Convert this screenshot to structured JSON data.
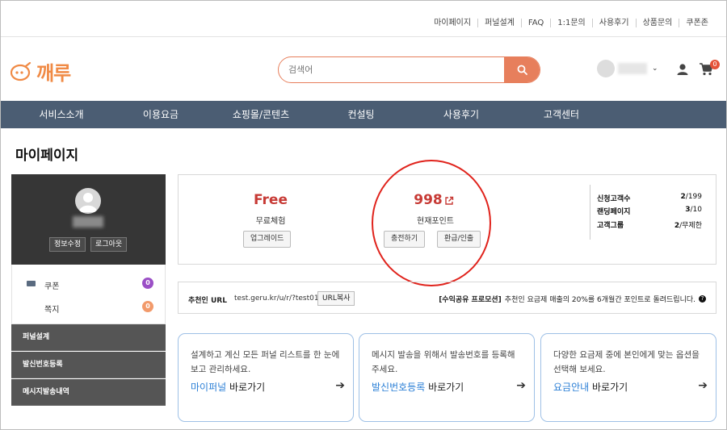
{
  "top_links": [
    "마이페이지",
    "퍼널설계",
    "FAQ",
    "1:1문의",
    "사용후기",
    "상품문의",
    "쿠폰존"
  ],
  "logo": {
    "text": "깨루"
  },
  "search": {
    "placeholder": "검색어"
  },
  "user": {
    "caret": "⌄"
  },
  "cart": {
    "count": "0"
  },
  "nav": [
    "서비스소개",
    "이용요금",
    "쇼핑몰/콘텐츠",
    "컨설팅",
    "사용후기",
    "고객센터"
  ],
  "page_title": "마이페이지",
  "profile": {
    "edit_label": "정보수정",
    "logout_label": "로그아웃"
  },
  "side_menu": [
    {
      "label": "쿠폰",
      "count": "0",
      "color": "#9b4fc6"
    },
    {
      "label": "쪽지",
      "count": "0",
      "color": "#f29a6b"
    }
  ],
  "side_dark": [
    "퍼널설계",
    "발신번호등록",
    "메시지발송내역"
  ],
  "summary": {
    "plan_value": "Free",
    "plan_label": "무료체험",
    "upgrade_label": "업그레이드",
    "points_value": "998",
    "points_label": "현재포인트",
    "charge_label": "충전하기",
    "refund_label": "환급/인출",
    "counts": [
      {
        "label": "신청고객수",
        "value": "2",
        "max": "/199"
      },
      {
        "label": "랜딩페이지",
        "value": "3",
        "max": "/10"
      },
      {
        "label": "고객그룹",
        "value": "2",
        "max": "/무제한"
      }
    ]
  },
  "referral": {
    "label": "추천인 URL",
    "url": "test.geru.kr/u/r/?test01",
    "copy_label": "URL복사",
    "promo_tag": "[수익공유 프로모션]",
    "promo_text": "추천인 요금제 매출의 20%를 6개월간 포인트로 돌려드립니다."
  },
  "cards": [
    {
      "desc": "설계하고 계신 모든 퍼널 리스트를 한 눈에 보고 관리하세요.",
      "link_hl": "마이퍼널",
      "link_rest": " 바로가기"
    },
    {
      "desc": "메시지 발송을 위해서 발송번호를 등록해 주세요.",
      "link_hl": "발신번호등록",
      "link_rest": " 바로가기"
    },
    {
      "desc": "다양한 요금제 중에 본인에게 맞는 옵션을 선택해 보세요.",
      "link_hl": "요금안내",
      "link_rest": " 바로가기"
    }
  ],
  "colors": {
    "accent": "#e77f5c",
    "nav_bg": "#4b5d73",
    "highlight": "#c73a35",
    "card_border": "#9ec0e6"
  }
}
